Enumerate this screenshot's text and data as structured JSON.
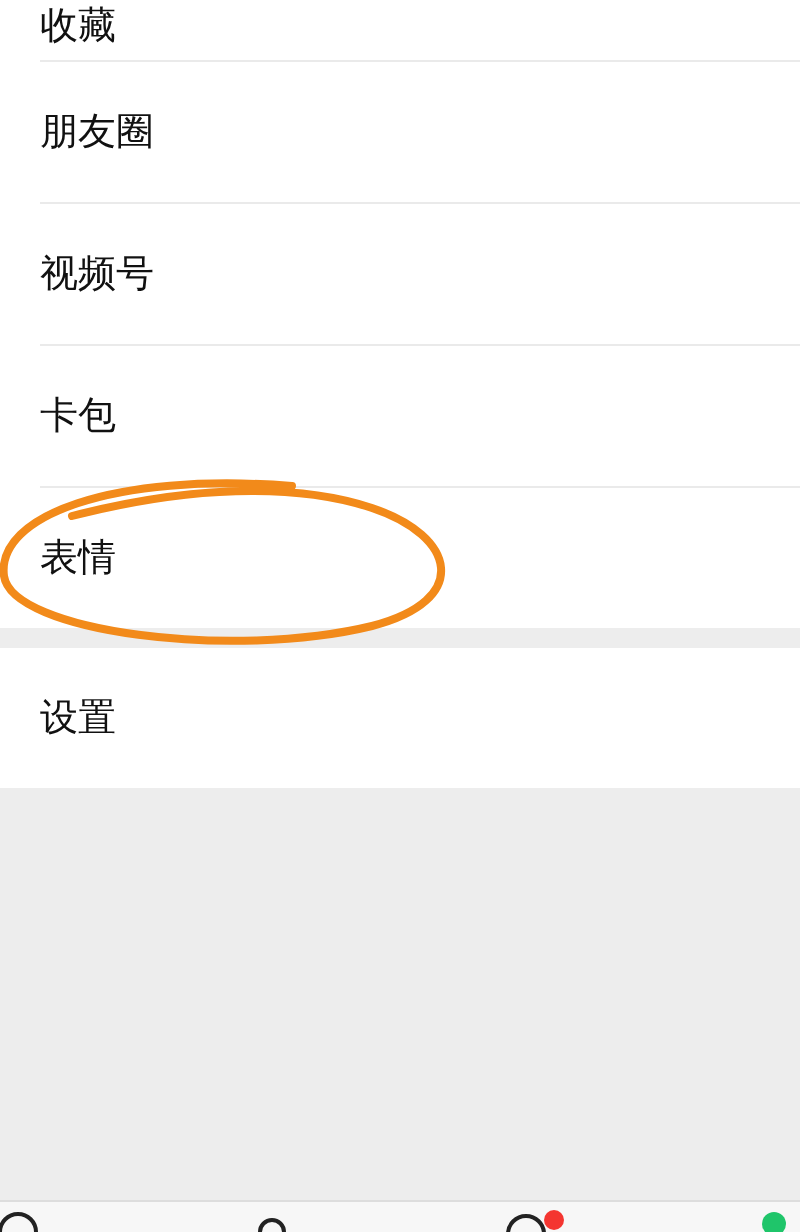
{
  "menu_groups": [
    {
      "items": [
        {
          "label": "收藏"
        },
        {
          "label": "朋友圈"
        },
        {
          "label": "视频号"
        },
        {
          "label": "卡包"
        },
        {
          "label": "表情",
          "circled": true
        }
      ]
    },
    {
      "items": [
        {
          "label": "设置"
        }
      ]
    }
  ]
}
